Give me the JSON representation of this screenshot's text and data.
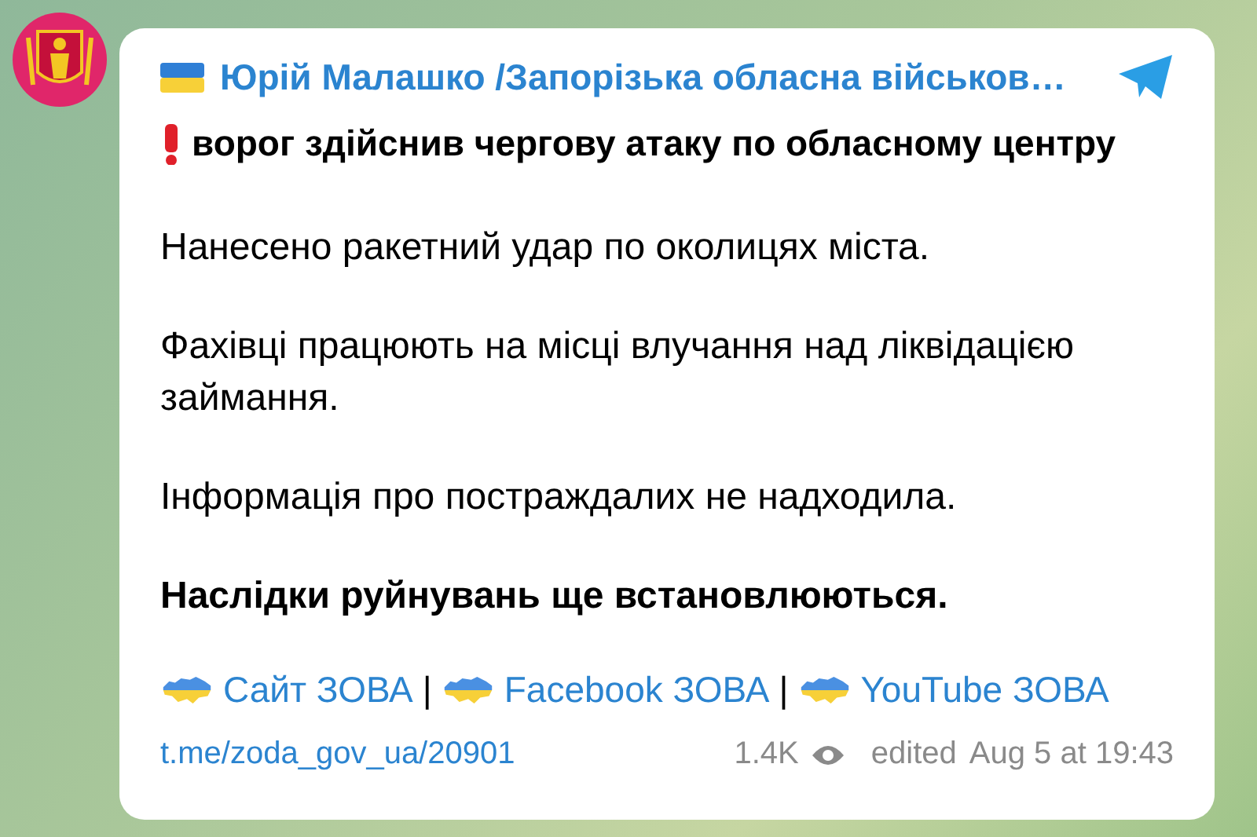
{
  "channel": {
    "name": "Юрій Малашко /Запорізька обласна військов…"
  },
  "message": {
    "headline": "ворог здійснив чергову атаку по обласному центру",
    "paragraphs": [
      {
        "text": "Нанесено ракетний удар по околицях міста.",
        "bold": false
      },
      {
        "text": "Фахівці працюють на місці влучання над ліквідацією займання.",
        "bold": false
      },
      {
        "text": "Інформація про постраждалих не надходила.",
        "bold": false
      },
      {
        "text": "Наслідки руйнувань ще встановлюються.",
        "bold": true
      }
    ],
    "links": [
      {
        "label": "Сайт ЗОВА"
      },
      {
        "separator": "|",
        "label": "Facebook ЗОВА"
      },
      {
        "separator": "|",
        "label": "YouTube ЗОВА"
      }
    ]
  },
  "footer": {
    "post_link": "t.me/zoda_gov_ua/20901",
    "views": "1.4K",
    "edited": "edited",
    "time": "Aug 5 at 19:43"
  }
}
